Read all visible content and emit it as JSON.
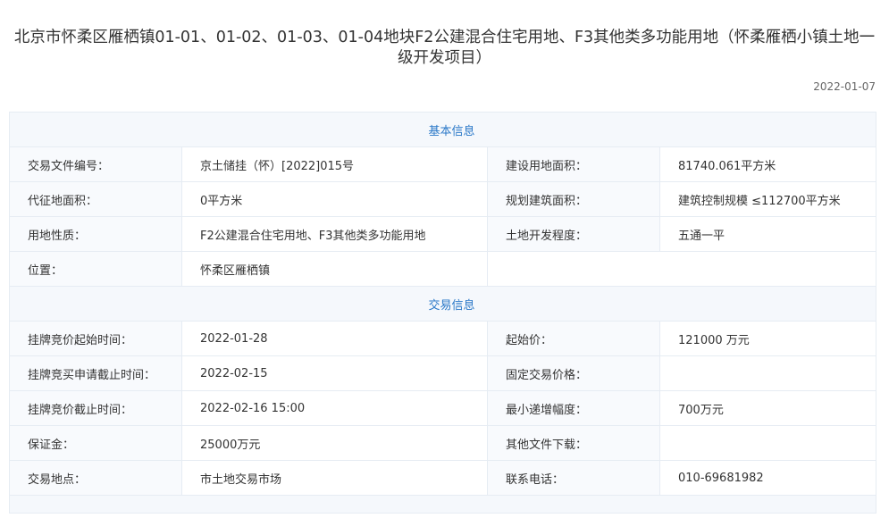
{
  "title_line1": "北京市怀柔区雁栖镇01-01、01-02、01-03、01-04地块F2公建混合住宅用地、F3其他类多功能用地（怀柔雁栖小镇土地一",
  "title_line2": "级开发项目）",
  "date": "2022-01-07",
  "basic_section_title": "基本信息",
  "basic_rows": [
    {
      "l1": "交易文件编号：",
      "v1": "京土储挂（怀）[2022]015号",
      "l2": "建设用地面积：",
      "v2": "81740.061平方米"
    },
    {
      "l1": "代征地面积：",
      "v1": "0平方米",
      "l2": "规划建筑面积：",
      "v2": "建筑控制规模 ≤112700平方米"
    },
    {
      "l1": "用地性质：",
      "v1": "F2公建混合住宅用地、F3其他类多功能用地",
      "l2": "土地开发程度：",
      "v2": "五通一平"
    },
    {
      "l1": "位置：",
      "v1": "怀柔区雁栖镇",
      "l2": "",
      "v2": ""
    }
  ],
  "trade_section_title": "交易信息",
  "trade_rows": [
    {
      "l1": "挂牌竞价起始时间：",
      "v1": "2022-01-28",
      "l2": "起始价：",
      "v2": "121000 万元"
    },
    {
      "l1": "挂牌竞买申请截止时间：",
      "v1": "2022-02-15",
      "l2": "固定交易价格：",
      "v2": ""
    },
    {
      "l1": "挂牌竞价截止时间：",
      "v1": "2022-02-16 15:00",
      "l2": "最小递增幅度：",
      "v2": "700万元"
    },
    {
      "l1": "保证金：",
      "v1": "25000万元",
      "l2": "其他文件下载：",
      "v2": ""
    },
    {
      "l1": "交易地点：",
      "v1": "市土地交易市场",
      "l2": "联系电话：",
      "v2": "010-69681982"
    }
  ]
}
